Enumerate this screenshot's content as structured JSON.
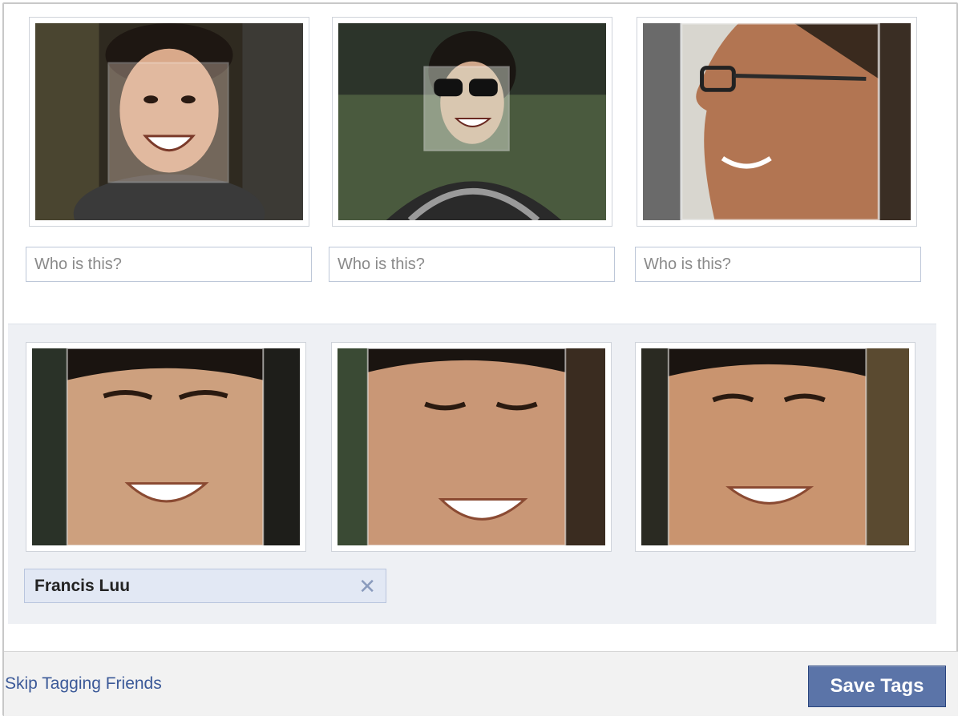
{
  "top_row": {
    "inputs": [
      {
        "placeholder": "Who is this?",
        "value": ""
      },
      {
        "placeholder": "Who is this?",
        "value": ""
      },
      {
        "placeholder": "Who is this?",
        "value": ""
      }
    ]
  },
  "suggestion": {
    "tag_name": "Francis Luu",
    "remove_glyph": "✕"
  },
  "footer": {
    "skip_label": "Skip Tagging Friends",
    "save_label": "Save Tags"
  },
  "colors": {
    "link": "#3b5998",
    "button": "#5b74a8",
    "token_bg": "#e2e8f4",
    "panel_bg": "#eef0f4"
  }
}
